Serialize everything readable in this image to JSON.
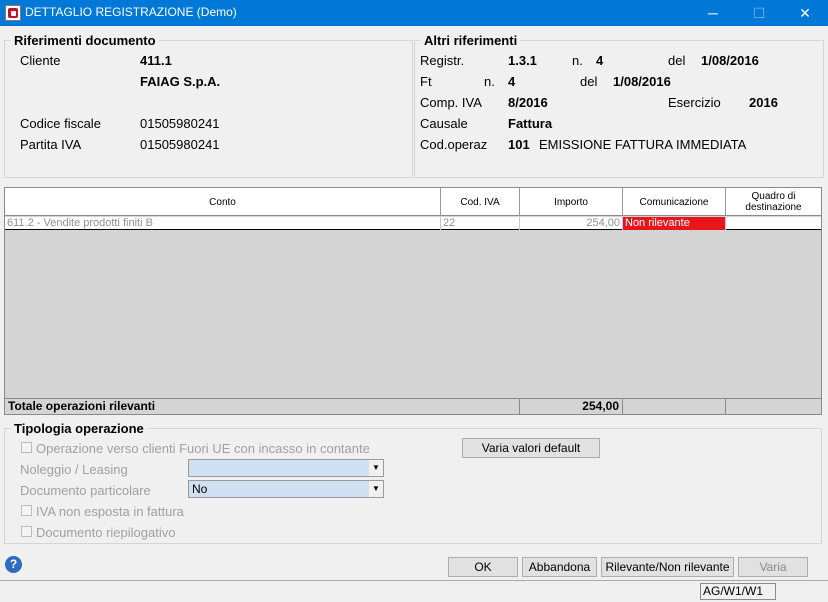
{
  "window": {
    "title": "DETTAGLIO REGISTRAZIONE  (Demo)",
    "min": "─",
    "max": "☐",
    "close": "✕"
  },
  "rif_doc": {
    "title": "Riferimenti documento",
    "cliente_label": "Cliente",
    "cliente_code": "411.1",
    "cliente_name": "FAIAG S.p.A.",
    "cf_label": "Codice fiscale",
    "cf_value": "01505980241",
    "piva_label": "Partita IVA",
    "piva_value": "01505980241"
  },
  "altri_rif": {
    "title": "Altri riferimenti",
    "registr_label": "Registr.",
    "registr_value": "1.3.1",
    "n_label": "n.",
    "registr_n": "4",
    "del_label": "del",
    "registr_date": "1/08/2016",
    "ft_label": "Ft",
    "ft_n_label": "n.",
    "ft_n": "4",
    "ft_del_label": "del",
    "ft_date": "1/08/2016",
    "comp_iva_label": "Comp. IVA",
    "comp_iva_value": "8/2016",
    "esercizio_label": "Esercizio",
    "esercizio_value": "2016",
    "causale_label": "Causale",
    "causale_value": "Fattura",
    "codop_label": "Cod.operaz",
    "codop_code": "101",
    "codop_desc": "EMISSIONE FATTURA IMMEDIATA"
  },
  "grid": {
    "headers": [
      "Conto",
      "Cod. IVA",
      "Importo",
      "Comunicazione",
      "Quadro di destinazione"
    ],
    "rows": [
      {
        "conto": "611.2 - Vendite prodotti finiti B",
        "cod_iva": "22",
        "importo": "254,00",
        "comunicazione": "Non rilevante",
        "quadro": ""
      }
    ],
    "total_label": "Totale operazioni rilevanti",
    "total_value": "254,00"
  },
  "tipologia": {
    "title": "Tipologia operazione",
    "chk_fuori_ue": "Operazione verso clienti Fuori UE con incasso in contante",
    "varia_default": "Varia valori default",
    "noleggio_label": "Noleggio / Leasing",
    "noleggio_value": "",
    "doc_part_label": "Documento particolare",
    "doc_part_value": "No",
    "chk_iva_non_esposta": "IVA non esposta in fattura",
    "chk_riepilogativo": "Documento riepilogativo"
  },
  "buttons": {
    "ok": "OK",
    "abbandona": "Abbandona",
    "rilevante": "Rilevante/Non rilevante",
    "varia": "Varia"
  },
  "status": "AG/W1/W1",
  "help": "?"
}
